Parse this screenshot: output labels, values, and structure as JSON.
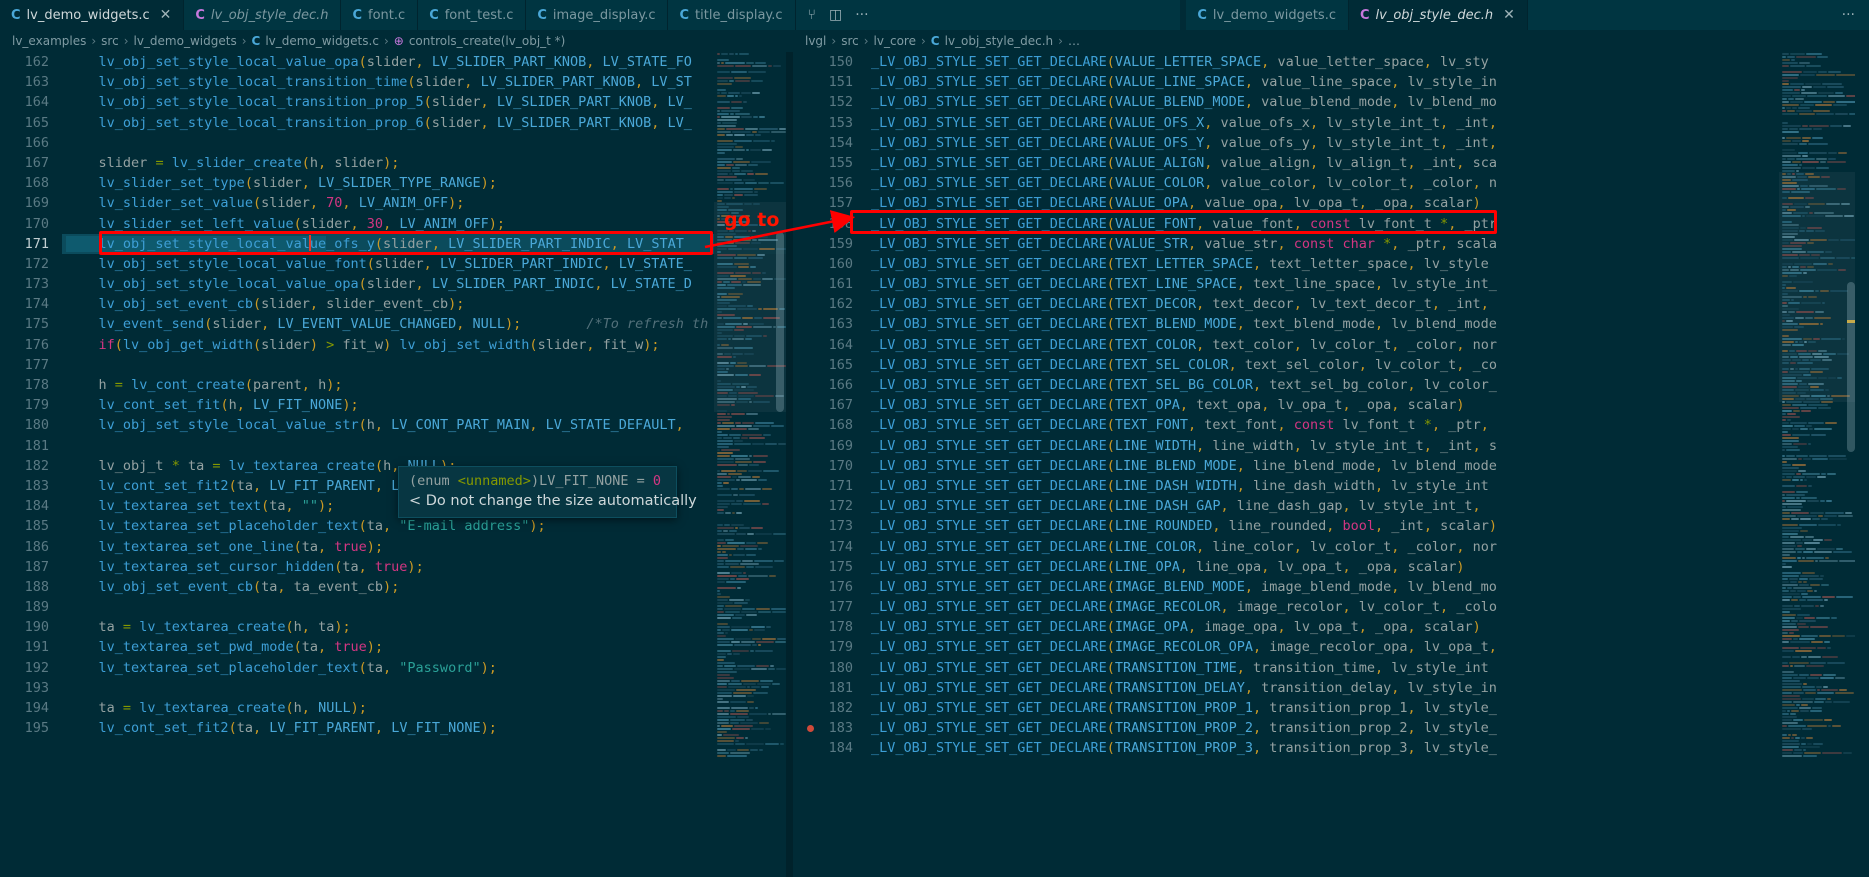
{
  "window": {
    "accent_red": "#ff0000",
    "bg": "#002b36",
    "tabbar_bg": "#003541"
  },
  "tabbar": {
    "left_group": [
      {
        "icon": "c-file-icon",
        "icon_color": "blue",
        "label": "lv_demo_widgets.c",
        "active": true,
        "italic": false,
        "closable": true
      },
      {
        "icon": "c-file-icon",
        "icon_color": "pink",
        "label": "lv_obj_style_dec.h",
        "active": false,
        "italic": true,
        "closable": false
      },
      {
        "icon": "c-file-icon",
        "icon_color": "blue",
        "label": "font.c",
        "active": false,
        "italic": false,
        "closable": false
      },
      {
        "icon": "c-file-icon",
        "icon_color": "blue",
        "label": "font_test.c",
        "active": false,
        "italic": false,
        "closable": false
      },
      {
        "icon": "c-file-icon",
        "icon_color": "blue",
        "label": "image_display.c",
        "active": false,
        "italic": false,
        "closable": false
      },
      {
        "icon": "c-file-icon",
        "icon_color": "blue",
        "label": "title_display.c",
        "active": false,
        "italic": false,
        "closable": false
      }
    ],
    "left_actions": [
      {
        "name": "source-control-icon",
        "glyph": "⑂"
      },
      {
        "name": "split-editor-icon",
        "glyph": "◫"
      },
      {
        "name": "more-actions-icon",
        "glyph": "···"
      }
    ],
    "right_group": [
      {
        "icon": "c-file-icon",
        "icon_color": "blue",
        "label": "lv_demo_widgets.c",
        "active": false,
        "italic": false,
        "closable": false
      },
      {
        "icon": "c-file-icon",
        "icon_color": "pink",
        "label": "lv_obj_style_dec.h",
        "active": true,
        "italic": true,
        "closable": true
      }
    ],
    "right_actions": [
      {
        "name": "more-actions-icon",
        "glyph": "···"
      }
    ]
  },
  "breadcrumbs": {
    "left": [
      {
        "text": "lv_examples",
        "kind": "plain"
      },
      {
        "text": "src",
        "kind": "plain"
      },
      {
        "text": "lv_demo_widgets",
        "kind": "plain"
      },
      {
        "text": "lv_demo_widgets.c",
        "kind": "file"
      },
      {
        "text": "controls_create(lv_obj_t *)",
        "kind": "symbol"
      }
    ],
    "right": [
      {
        "text": "lvgl",
        "kind": "plain"
      },
      {
        "text": "src",
        "kind": "plain"
      },
      {
        "text": "lv_core",
        "kind": "plain"
      },
      {
        "text": "lv_obj_style_dec.h",
        "kind": "file"
      },
      {
        "text": "…",
        "kind": "plain"
      }
    ]
  },
  "annotations": {
    "goto_label": "go to",
    "left_box_line": 171,
    "right_box_line": 158
  },
  "tooltip": {
    "signature": "(enum <unnamed>)LV_FIT_NONE = 0",
    "doc": "< Do not change the size automatically"
  },
  "left_editor": {
    "first_line": 162,
    "current_line": 171,
    "lines": [
      {
        "n": 162,
        "text": "    lv_obj_set_style_local_value_opa(slider, LV_SLIDER_PART_KNOB, LV_STATE_FO"
      },
      {
        "n": 163,
        "text": "    lv_obj_set_style_local_transition_time(slider, LV_SLIDER_PART_KNOB, LV_ST"
      },
      {
        "n": 164,
        "text": "    lv_obj_set_style_local_transition_prop_5(slider, LV_SLIDER_PART_KNOB, LV_"
      },
      {
        "n": 165,
        "text": "    lv_obj_set_style_local_transition_prop_6(slider, LV_SLIDER_PART_KNOB, LV_"
      },
      {
        "n": 166,
        "text": ""
      },
      {
        "n": 167,
        "text": "    slider = lv_slider_create(h, slider);"
      },
      {
        "n": 168,
        "text": "    lv_slider_set_type(slider, LV_SLIDER_TYPE_RANGE);"
      },
      {
        "n": 169,
        "text": "    lv_slider_set_value(slider, 70, LV_ANIM_OFF);"
      },
      {
        "n": 170,
        "text": "    lv_slider_set_left_value(slider, 30, LV_ANIM_OFF);"
      },
      {
        "n": 171,
        "text": "    lv_obj_set_style_local_value_ofs_y(slider, LV_SLIDER_PART_INDIC, LV_STAT"
      },
      {
        "n": 172,
        "text": "    lv_obj_set_style_local_value_font(slider, LV_SLIDER_PART_INDIC, LV_STATE_"
      },
      {
        "n": 173,
        "text": "    lv_obj_set_style_local_value_opa(slider, LV_SLIDER_PART_INDIC, LV_STATE_D"
      },
      {
        "n": 174,
        "text": "    lv_obj_set_event_cb(slider, slider_event_cb);"
      },
      {
        "n": 175,
        "text": "    lv_event_send(slider, LV_EVENT_VALUE_CHANGED, NULL);        /*To refresh th"
      },
      {
        "n": 176,
        "text": "    if(lv_obj_get_width(slider) > fit_w) lv_obj_set_width(slider, fit_w);"
      },
      {
        "n": 177,
        "text": ""
      },
      {
        "n": 178,
        "text": "    h = lv_cont_create(parent, h);"
      },
      {
        "n": 179,
        "text": "    lv_cont_set_fit(h, LV_FIT_NONE);"
      },
      {
        "n": 180,
        "text": "    lv_obj_set_style_local_value_str(h, LV_CONT_PART_MAIN, LV_STATE_DEFAULT,"
      },
      {
        "n": 181,
        "text": ""
      },
      {
        "n": 182,
        "text": "    lv_obj_t * ta = lv_textarea_create(h, NULL);"
      },
      {
        "n": 183,
        "text": "    lv_cont_set_fit2(ta, LV_FIT_PARENT, LV_FIT_NONE);"
      },
      {
        "n": 184,
        "text": "    lv_textarea_set_text(ta, \"\");"
      },
      {
        "n": 185,
        "text": "    lv_textarea_set_placeholder_text(ta, \"E-mail address\");"
      },
      {
        "n": 186,
        "text": "    lv_textarea_set_one_line(ta, true);"
      },
      {
        "n": 187,
        "text": "    lv_textarea_set_cursor_hidden(ta, true);"
      },
      {
        "n": 188,
        "text": "    lv_obj_set_event_cb(ta, ta_event_cb);"
      },
      {
        "n": 189,
        "text": ""
      },
      {
        "n": 190,
        "text": "    ta = lv_textarea_create(h, ta);"
      },
      {
        "n": 191,
        "text": "    lv_textarea_set_pwd_mode(ta, true);"
      },
      {
        "n": 192,
        "text": "    lv_textarea_set_placeholder_text(ta, \"Password\");"
      },
      {
        "n": 193,
        "text": ""
      },
      {
        "n": 194,
        "text": "    ta = lv_textarea_create(h, NULL);"
      },
      {
        "n": 195,
        "text": "    lv_cont_set_fit2(ta, LV_FIT_PARENT, LV_FIT_NONE);"
      }
    ]
  },
  "right_editor": {
    "first_line": 150,
    "macro_name": "_LV_OBJ_STYLE_SET_GET_DECLARE",
    "lines": [
      {
        "n": 150,
        "args": "VALUE_LETTER_SPACE, value_letter_space, lv_sty"
      },
      {
        "n": 151,
        "args": "VALUE_LINE_SPACE, value_line_space, lv_style_in"
      },
      {
        "n": 152,
        "args": "VALUE_BLEND_MODE, value_blend_mode, lv_blend_mo"
      },
      {
        "n": 153,
        "args": "VALUE_OFS_X, value_ofs_x, lv_style_int_t, _int,"
      },
      {
        "n": 154,
        "args": "VALUE_OFS_Y, value_ofs_y, lv_style_int_t, _int,"
      },
      {
        "n": 155,
        "args": "VALUE_ALIGN, value_align, lv_align_t, _int, sca"
      },
      {
        "n": 156,
        "args": "VALUE_COLOR, value_color, lv_color_t, _color, n"
      },
      {
        "n": 157,
        "args": "VALUE_OPA, value_opa, lv_opa_t, _opa, scalar)"
      },
      {
        "n": 158,
        "args": "VALUE_FONT, value_font, const lv_font_t *, _ptr"
      },
      {
        "n": 159,
        "args": "VALUE_STR, value_str, const char *, _ptr, scala"
      },
      {
        "n": 160,
        "args": "TEXT_LETTER_SPACE, text_letter_space, lv_style"
      },
      {
        "n": 161,
        "args": "TEXT_LINE_SPACE, text_line_space, lv_style_int_"
      },
      {
        "n": 162,
        "args": "TEXT_DECOR, text_decor, lv_text_decor_t, _int,"
      },
      {
        "n": 163,
        "args": "TEXT_BLEND_MODE, text_blend_mode, lv_blend_mode"
      },
      {
        "n": 164,
        "args": "TEXT_COLOR, text_color, lv_color_t, _color, nor"
      },
      {
        "n": 165,
        "args": "TEXT_SEL_COLOR, text_sel_color, lv_color_t, _co"
      },
      {
        "n": 166,
        "args": "TEXT_SEL_BG_COLOR, text_sel_bg_color, lv_color_"
      },
      {
        "n": 167,
        "args": "TEXT_OPA, text_opa, lv_opa_t, _opa, scalar)"
      },
      {
        "n": 168,
        "args": "TEXT_FONT, text_font, const lv_font_t *, _ptr,"
      },
      {
        "n": 169,
        "args": "LINE_WIDTH, line_width, lv_style_int_t, _int, s"
      },
      {
        "n": 170,
        "args": "LINE_BLEND_MODE, line_blend_mode, lv_blend_mode"
      },
      {
        "n": 171,
        "args": "LINE_DASH_WIDTH, line_dash_width, lv_style_int"
      },
      {
        "n": 172,
        "args": "LINE_DASH_GAP, line_dash_gap, lv_style_int_t,"
      },
      {
        "n": 173,
        "args": "LINE_ROUNDED, line_rounded, bool, _int, scalar)"
      },
      {
        "n": 174,
        "args": "LINE_COLOR, line_color, lv_color_t, _color, nor"
      },
      {
        "n": 175,
        "args": "LINE_OPA, line_opa, lv_opa_t, _opa, scalar)"
      },
      {
        "n": 176,
        "args": "IMAGE_BLEND_MODE, image_blend_mode, lv_blend_mo"
      },
      {
        "n": 177,
        "args": "IMAGE_RECOLOR, image_recolor, lv_color_t, _colo"
      },
      {
        "n": 178,
        "args": "IMAGE_OPA, image_opa, lv_opa_t, _opa, scalar)"
      },
      {
        "n": 179,
        "args": "IMAGE_RECOLOR_OPA, image_recolor_opa, lv_opa_t,"
      },
      {
        "n": 180,
        "args": "TRANSITION_TIME, transition_time, lv_style_int"
      },
      {
        "n": 181,
        "args": "TRANSITION_DELAY, transition_delay, lv_style_in"
      },
      {
        "n": 182,
        "args": "TRANSITION_PROP_1, transition_prop_1, lv_style_"
      },
      {
        "n": 183,
        "args": "TRANSITION_PROP_2, transition_prop_2, lv_style_"
      },
      {
        "n": 184,
        "args": "TRANSITION_PROP_3, transition_prop_3, lv_style_"
      }
    ],
    "breakpoint_line": 183
  }
}
